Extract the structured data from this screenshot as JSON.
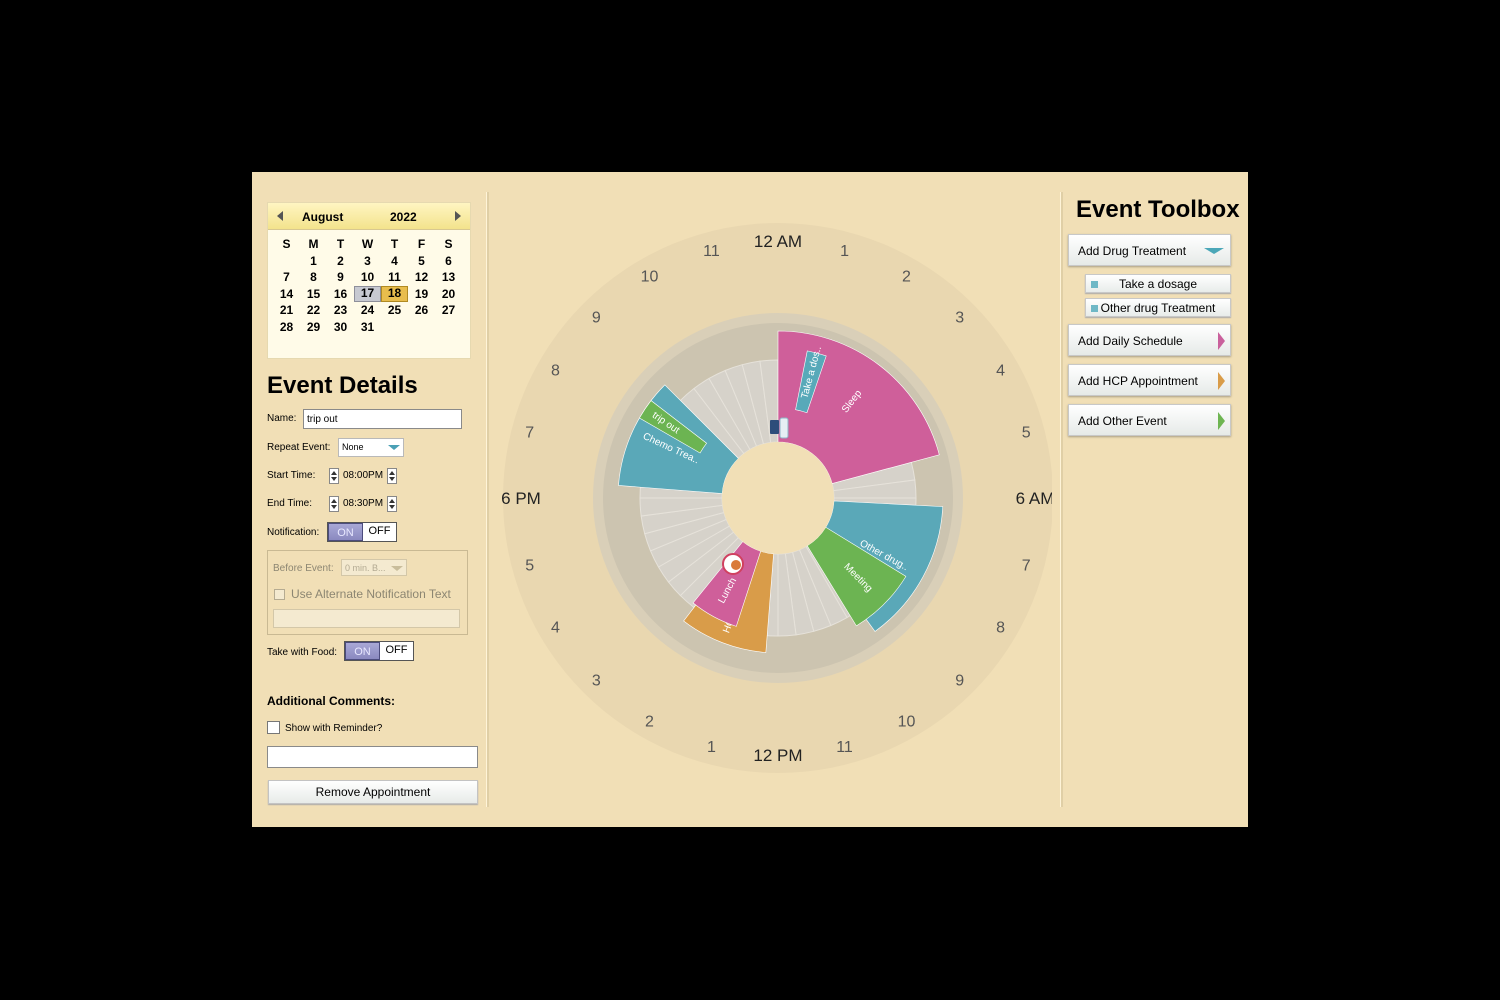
{
  "calendar": {
    "month": "August",
    "year": "2022",
    "weekdays": [
      "S",
      "M",
      "T",
      "W",
      "T",
      "F",
      "S"
    ],
    "first_weekday": 1,
    "days_in_month": 31,
    "today": 17,
    "selected": 18
  },
  "details": {
    "title": "Event Details",
    "name_label": "Name:",
    "name_value": "trip out",
    "repeat_label": "Repeat Event:",
    "repeat_value": "None",
    "start_label": "Start Time:",
    "start_value": "08:00PM",
    "end_label": "End Time:",
    "end_value": "08:30PM",
    "notification_label": "Notification:",
    "on": "ON",
    "off": "OFF",
    "before_event_label": "Before Event:",
    "before_event_value": "0 min. B...",
    "alt_text_label": "Use Alternate Notification Text",
    "food_label": "Take with Food:",
    "comments_label": "Additional Comments:",
    "show_reminder_label": "Show with Reminder?",
    "remove_button": "Remove Appointment"
  },
  "toolbox": {
    "title": "Event Toolbox",
    "add_drug": "Add Drug Treatment",
    "sub_items": [
      "Take a dosage",
      "Other drug Treatment"
    ],
    "add_daily": "Add Daily Schedule",
    "add_hcp": "Add HCP Appointment",
    "add_other": "Add Other Event",
    "colors": {
      "drug": "#4ba7b8",
      "daily": "#c9609c",
      "hcp": "#d99c49",
      "other": "#6eb552"
    }
  },
  "clock": {
    "hours": [
      "12 AM",
      "1",
      "2",
      "3",
      "4",
      "5",
      "6 AM",
      "7",
      "8",
      "9",
      "10",
      "11",
      "12 PM",
      "1",
      "2",
      "3",
      "4",
      "5",
      "6 PM",
      "7",
      "8",
      "9",
      "10",
      "11"
    ],
    "events": [
      {
        "label": "Sleep",
        "start": 0,
        "end": 5,
        "color": "#cf5f9a"
      },
      {
        "label": "Take a dos..",
        "start": 0.75,
        "end": 1.25,
        "color": "#58a9b9"
      },
      {
        "label": "Other drug..",
        "start": 6.2,
        "end": 9.6,
        "color": "#5aa8b8"
      },
      {
        "label": "Meeting",
        "start": 8.1,
        "end": 9.9,
        "color": "#6cb452"
      },
      {
        "label": "HCP App. a..",
        "start": 12.3,
        "end": 14.5,
        "color": "#d99c49"
      },
      {
        "label": "Lunch",
        "start": 13.2,
        "end": 14.6,
        "color": "#cf5f9a"
      },
      {
        "label": "Chemo Trea..",
        "start": 18.3,
        "end": 21,
        "color": "#5aa8b8"
      },
      {
        "label": "trip out",
        "start": 20,
        "end": 20.5,
        "color": "#6cb452"
      }
    ]
  }
}
